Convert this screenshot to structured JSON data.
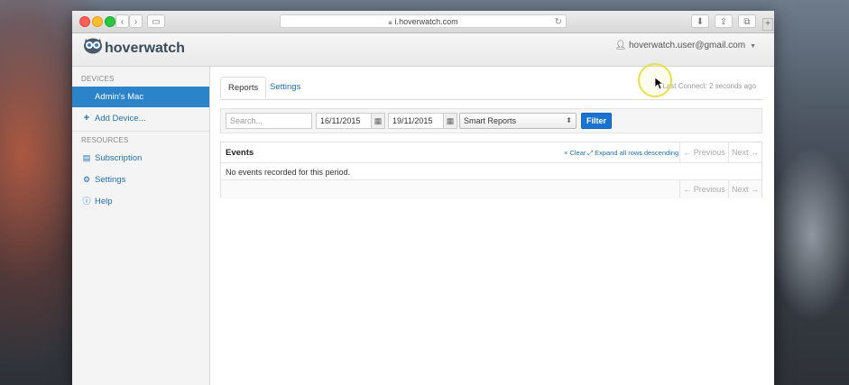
{
  "browser": {
    "url": "i.hoverwatch.com",
    "nav_back": "‹",
    "nav_forward": "›"
  },
  "app": {
    "logo_text": "hoverwatch",
    "user_email": "hoverwatch.user@gmail.com"
  },
  "sidebar": {
    "devices_heading": "DEVICES",
    "resources_heading": "RESOURCES",
    "items": [
      {
        "label": "Admin's Mac",
        "icon": "apple-icon",
        "active": true
      },
      {
        "label": "Add Device...",
        "icon": "plus-icon",
        "active": false
      },
      {
        "label": "Subscription",
        "icon": "list-icon",
        "active": false
      },
      {
        "label": "Settings",
        "icon": "gear-icon",
        "active": false
      },
      {
        "label": "Help",
        "icon": "info-icon",
        "active": false
      }
    ]
  },
  "main": {
    "tabs": [
      {
        "label": "Reports",
        "active": true
      },
      {
        "label": "Settings",
        "active": false
      }
    ],
    "last_connect": "Last Connect: 2 seconds ago",
    "filter": {
      "search_placeholder": "Search...",
      "date_from": "16/11/2015",
      "date_to": "19/11/2015",
      "report_type": "Smart Reports",
      "filter_button": "Filter"
    },
    "events": {
      "title": "Events",
      "clear": "× Clear",
      "expand": "⤢ Expand all rows",
      "sort": "↓ descending",
      "previous": "← Previous",
      "next": "Next →",
      "empty_message": "No events recorded for this period."
    }
  },
  "colors": {
    "accent": "#2b83c9",
    "filter_button": "#1a73d1",
    "link": "#1f6fb2"
  }
}
